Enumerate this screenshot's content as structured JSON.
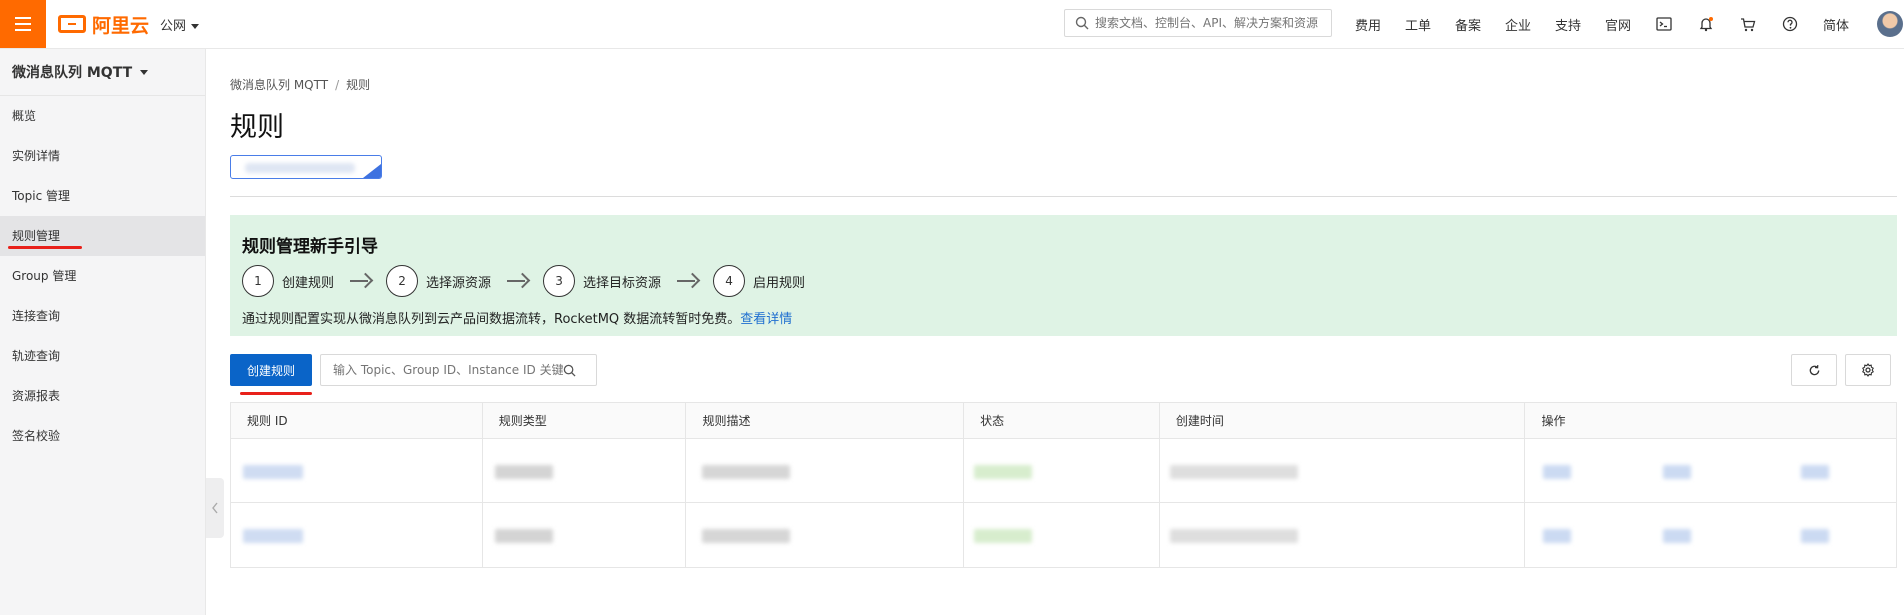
{
  "topbar": {
    "logo_text": "阿里云",
    "region_label": "公网",
    "search_placeholder": "搜索文档、控制台、API、解决方案和资源",
    "nav_items": [
      "费用",
      "工单",
      "备案",
      "企业",
      "支持",
      "官网"
    ],
    "lang_label": "简体",
    "accent_color": "#ff6a00"
  },
  "sidebar": {
    "product_title": "微消息队列 MQTT",
    "items": [
      {
        "label": "概览"
      },
      {
        "label": "实例详情"
      },
      {
        "label": "Topic 管理"
      },
      {
        "label": "规则管理"
      },
      {
        "label": "Group 管理"
      },
      {
        "label": "连接查询"
      },
      {
        "label": "轨迹查询"
      },
      {
        "label": "资源报表"
      },
      {
        "label": "签名校验"
      }
    ],
    "active_item": "规则管理"
  },
  "breadcrumb": {
    "parent": "微消息队列 MQTT",
    "separator": "/",
    "current": "规则"
  },
  "page_title": "规则",
  "guide": {
    "title": "规则管理新手引导",
    "steps": [
      {
        "num": "1",
        "label": "创建规则"
      },
      {
        "num": "2",
        "label": "选择源资源"
      },
      {
        "num": "3",
        "label": "选择目标资源"
      },
      {
        "num": "4",
        "label": "启用规则"
      }
    ],
    "description": "通过规则配置实现从微消息队列到云产品间数据流转，RocketMQ 数据流转暂时免费。",
    "link_text": "查看详情"
  },
  "toolbar": {
    "create_label": "创建规则",
    "filter_placeholder": "输入 Topic、Group ID、Instance ID 关键字"
  },
  "table": {
    "columns": [
      "规则 ID",
      "规则类型",
      "规则描述",
      "状态",
      "创建时间",
      "操作"
    ]
  }
}
